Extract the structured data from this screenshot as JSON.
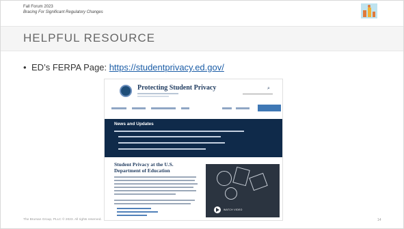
{
  "header": {
    "line1": "Fall Forum 2023",
    "line2": "Bracing For Significant Regulatory Changes"
  },
  "title": "HELPFUL RESOURCE",
  "bullet": {
    "label": "ED’s FERPA Page:",
    "link": "https://studentprivacy.ed.gov/"
  },
  "screenshot": {
    "site_title": "Protecting Student Privacy",
    "news_title": "News and Updates",
    "section_title": "Student Privacy at the U.S. Department of Education",
    "video_label": "WATCH VIDEO"
  },
  "footer": {
    "text": "The Bruman Group, PLLC © 2023. All rights reserved.",
    "page": "14"
  },
  "colors": {
    "accent_link": "#1a5ca6",
    "navy": "#0f2a4a"
  }
}
